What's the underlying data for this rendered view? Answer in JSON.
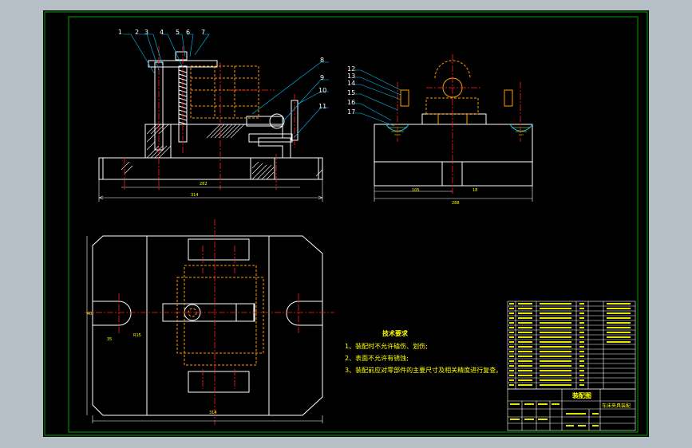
{
  "drawing": {
    "part_numbers": [
      "1",
      "2",
      "3",
      "4",
      "5",
      "6",
      "7",
      "8",
      "9",
      "10",
      "11",
      "12",
      "13",
      "14",
      "15",
      "16",
      "17"
    ],
    "dimensions": {
      "front_view_overall": "314",
      "front_view_inner": "282",
      "side_view_left": "105",
      "side_view_right": "18",
      "side_view_bottom": "288",
      "top_view_width": "314",
      "top_view_height": "40",
      "top_view_small_a": "35",
      "top_view_small_b": "R15"
    },
    "technical_requirements": {
      "title": "技术要求",
      "items": [
        "1、装配时不允许磕伤、划伤;",
        "2、表面不允许有锈蚀;",
        "3、装配前应对零部件的主要尺寸及相关精度进行复查。"
      ]
    },
    "title_block": {
      "drawing_title": "装配图",
      "drawing_name": "车床夹具装配"
    },
    "colors": {
      "frame": "#00a000",
      "outline": "#ffffff",
      "hidden": "#ff9900",
      "centerline": "#ff2020",
      "leader": "#00c8ff",
      "text": "#ffff00",
      "background": "#000000"
    }
  }
}
